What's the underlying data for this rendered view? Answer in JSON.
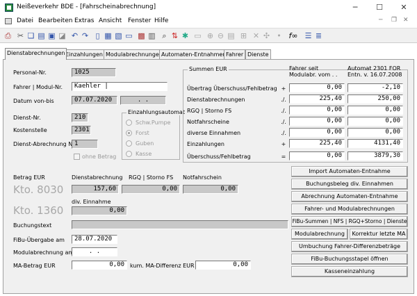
{
  "window": {
    "title": "Neißeverkehr BDE - [Fahrscheinabrechnung]"
  },
  "menu": [
    "Datei",
    "Bearbeiten",
    "Extras",
    "Ansicht",
    "Fenster",
    "Hilfe"
  ],
  "tabs": [
    "Dienstabrechnungen",
    "Einzahlungen",
    "Modulabrechnungen",
    "Automaten-Entnahmen",
    "Fahrer",
    "Dienste"
  ],
  "left": {
    "personal_nr_label": "Personal-Nr.",
    "personal_nr": "1025",
    "fahrer_label": "Fahrer | Modul-Nr.",
    "fahrer": "Kaehler |",
    "datum_label": "Datum von-bis",
    "datum_von": "07.07.2020",
    "datum_bis": ". .",
    "dienst_label": "Dienst-Nr.",
    "dienst": "210",
    "kostenstelle_label": "Kostenstelle",
    "kostenstelle": "2301",
    "dienst_abr_label": "Dienst-Abrechnung Nr.",
    "dienst_abr": "1",
    "ohne_betrag_label": "ohne Betrag"
  },
  "automat": {
    "caption": "Einzahlungsautomat",
    "options": [
      "Schw.Pumpe",
      "Forst",
      "Guben",
      "Kasse"
    ],
    "selected": "Forst"
  },
  "summen": {
    "caption": "Summen EUR",
    "col1_header": "Fahrer seit Modulabr. vom . .",
    "col2_header": "Automat 2301 FOR Entn. v. 16.07.2008",
    "rows": [
      {
        "label": "Übertrag Überschuss/Fehlbetrag",
        "sign": "+",
        "a": "0,00",
        "b": "-2,10"
      },
      {
        "label": "Dienstabrechnungen",
        "sign": "./.",
        "a": "225,40",
        "b": "250,00"
      },
      {
        "label": "RGQ | Storno FS",
        "sign": "./.",
        "a": "0,00",
        "b": "0,00"
      },
      {
        "label": "Notfahrscheine",
        "sign": "./.",
        "a": "0,00",
        "b": "0,00"
      },
      {
        "label": "diverse Einnahmen",
        "sign": "./.",
        "a": "0,00",
        "b": "0,00"
      },
      {
        "label": "Einzahlungen",
        "sign": "+",
        "a": "225,40",
        "b": "4131,40"
      },
      {
        "label": "Überschuss/Fehlbetrag",
        "sign": "=",
        "a": "0,00",
        "b": "3879,30"
      }
    ]
  },
  "betrag": {
    "label": "Betrag EUR",
    "dienst_label": "Dienstabrechnung",
    "rgq_label": "RGQ | Storno FS",
    "notfahr_label": "Notfahrschein",
    "kto1": "Kto. 8030",
    "dienst_val": "157,60",
    "rgq_val": "0,00",
    "notfahr_val": "0,00",
    "div_label": "div. Einnahme",
    "kto2": "Kto. 1360",
    "div_val": "0,00",
    "buchungstext_label": "Buchungstext",
    "fibu_label": "FiBu-Übergabe am",
    "fibu": "28.07.2020",
    "modul_label": "Modulabrechnung am",
    "modul": ". .",
    "ma_label": "MA-Betrag EUR",
    "ma": "0,00",
    "kum_label": "kum. MA-Differenz EUR",
    "kum": "0,00"
  },
  "buttons": {
    "import": "Import Automaten-Entnahme",
    "buchungsbeleg": "Buchungsbeleg div. Einnahmen",
    "abrechnung": "Abrechnung Automaten-Entnahme",
    "fahrer_modul": "Fahrer- und Modulabrechnungen",
    "fibu_summen": "FiBu-Summen | NFS | RGQ+Storno | Dienste",
    "modulabrechnung": "Modulabrechnung",
    "korrektur": "Korrektur letzte MA",
    "umbuchung": "Umbuchung Fahrer-Differenzbeträge",
    "fibu_stapel": "FiBu-Buchungsstapel öffnen",
    "kasse": "Kasseneinzahlung"
  }
}
